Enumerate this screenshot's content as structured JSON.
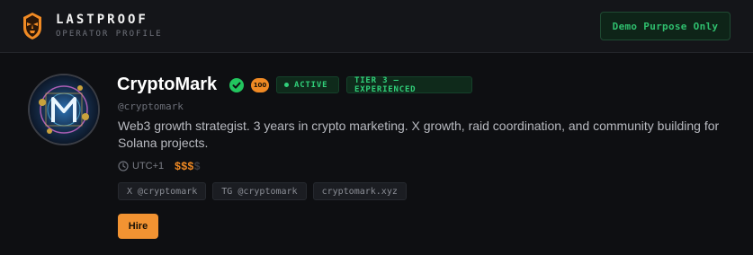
{
  "header": {
    "brand_name": "LASTPROOF",
    "brand_subtitle": "OPERATOR PROFILE",
    "demo_label": "Demo Purpose Only",
    "logo_icon": "masked-face-icon"
  },
  "profile": {
    "name": "CryptoMark",
    "verified_icon": "check-circle-icon",
    "score": "100",
    "status": "ACTIVE",
    "tier": "TIER 3 — EXPERIENCED",
    "handle": "@cryptomark",
    "bio": "Web3 growth strategist. 3 years in crypto marketing. X growth, raid coordination, and community building for Solana projects.",
    "timezone": "UTC+1",
    "price_active": "$$$",
    "price_inactive": "$",
    "tags": [
      "X @cryptomark",
      "TG @cryptomark",
      "cryptomark.xyz"
    ],
    "hire_label": "Hire"
  },
  "colors": {
    "accent_orange": "#f08a24",
    "status_green": "#31d07a",
    "background": "#0e0f12"
  }
}
